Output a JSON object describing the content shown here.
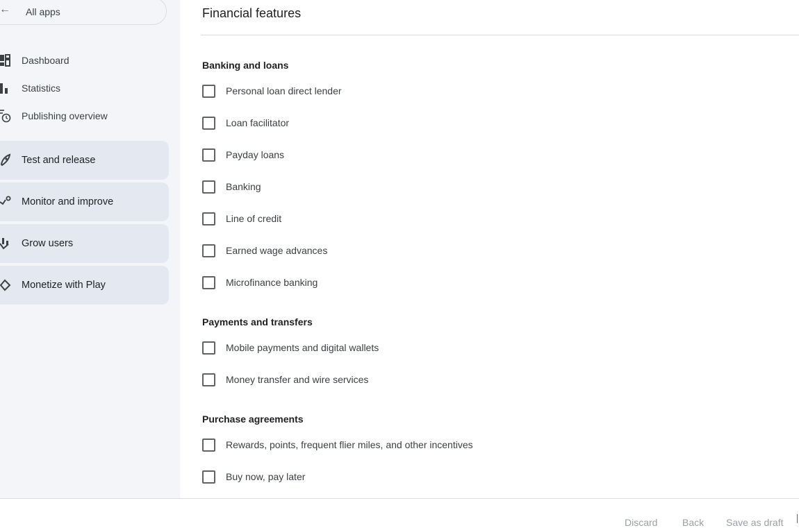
{
  "sidebar": {
    "all_apps_label": "All apps",
    "nav_items": [
      {
        "label": "Dashboard",
        "icon": "dashboard-icon"
      },
      {
        "label": "Statistics",
        "icon": "bar-chart-icon"
      },
      {
        "label": "Publishing overview",
        "icon": "publishing-clock-icon"
      }
    ],
    "sections": [
      {
        "label": "Test and release",
        "icon": "rocket-icon"
      },
      {
        "label": "Monitor and improve",
        "icon": "trend-icon"
      },
      {
        "label": "Grow users",
        "icon": "grow-users-icon"
      },
      {
        "label": "Monetize with Play",
        "icon": "tag-icon"
      }
    ]
  },
  "main": {
    "title": "Financial features",
    "groups": [
      {
        "heading": "Banking and loans",
        "options": [
          {
            "label": "Personal loan direct lender",
            "checked": false
          },
          {
            "label": "Loan facilitator",
            "checked": false
          },
          {
            "label": "Payday loans",
            "checked": false
          },
          {
            "label": "Banking",
            "checked": false
          },
          {
            "label": "Line of credit",
            "checked": false
          },
          {
            "label": "Earned wage advances",
            "checked": false
          },
          {
            "label": "Microfinance banking",
            "checked": false
          }
        ]
      },
      {
        "heading": "Payments and transfers",
        "options": [
          {
            "label": "Mobile payments and digital wallets",
            "checked": false
          },
          {
            "label": "Money transfer and wire services",
            "checked": false
          }
        ]
      },
      {
        "heading": "Purchase agreements",
        "options": [
          {
            "label": "Rewards, points, frequent flier miles, and other incentives",
            "checked": false
          },
          {
            "label": "Buy now, pay later",
            "checked": false
          }
        ]
      }
    ]
  },
  "footer": {
    "discard_label": "Discard",
    "back_label": "Back",
    "save_draft_label": "Save as draft"
  },
  "colors": {
    "sidebar_bg": "#f3f5f9",
    "section_bg": "#e4e9f1",
    "checkbox_border": "#5f6368",
    "disabled_text": "#9aa0a6"
  }
}
